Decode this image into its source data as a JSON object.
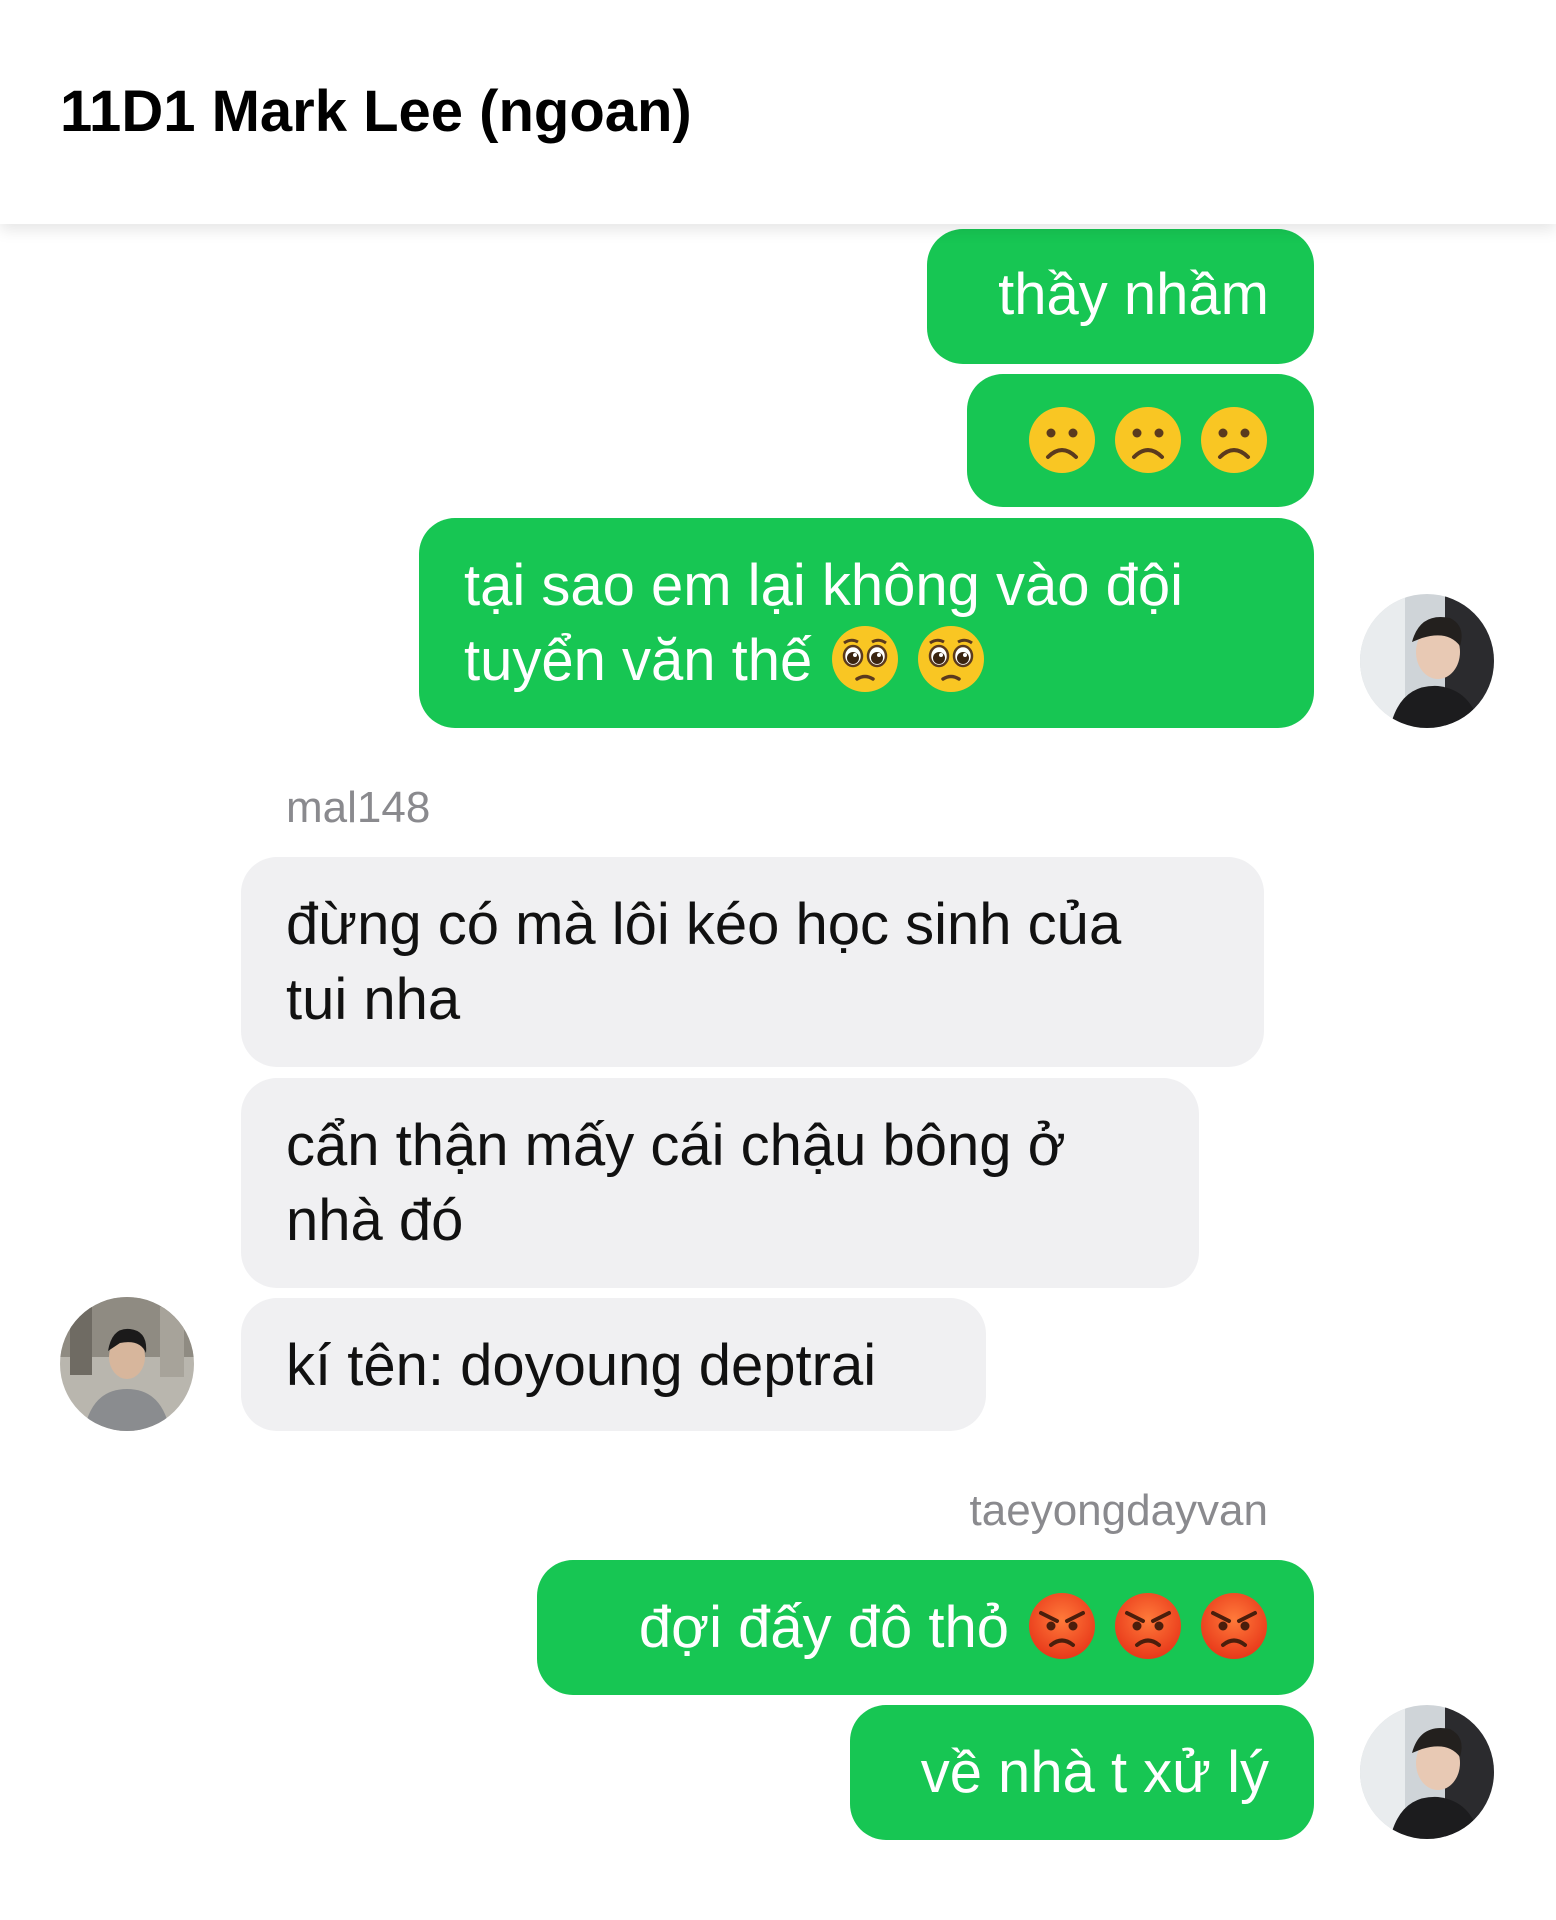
{
  "header": {
    "title": "11D1 Mark Lee (ngoan)"
  },
  "messages": {
    "m1": {
      "text": "thầy nhầm"
    },
    "m2": {
      "emojis": [
        "frowning-face",
        "frowning-face",
        "frowning-face"
      ]
    },
    "m3": {
      "line1": "tại sao em lại không vào đội",
      "line2": "tuyển văn thế",
      "emojis": [
        "pleading-face",
        "pleading-face"
      ]
    },
    "group2": {
      "sender": "mal148",
      "m4": {
        "line1": "đừng có mà lôi kéo học sinh của",
        "line2": "tui nha"
      },
      "m5": {
        "line1": "cẩn thận mấy cái chậu bông ở",
        "line2": "nhà đó"
      },
      "m6": {
        "text": "kí tên: doyoung deptrai"
      }
    },
    "group3": {
      "sender": "taeyongdayvan",
      "m7": {
        "text": "đợi đấy đô thỏ",
        "emojis": [
          "angry-face",
          "angry-face",
          "angry-face"
        ]
      },
      "m8": {
        "text": "về nhà t xử lý"
      }
    }
  },
  "colors": {
    "outgoing_bubble": "#17c653",
    "incoming_bubble": "#f0f0f2",
    "sender_name": "#8a8a8e"
  }
}
